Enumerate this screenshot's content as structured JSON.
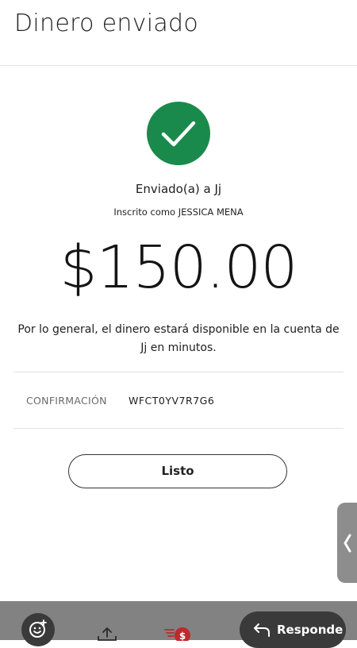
{
  "header": {
    "title": "Dinero enviado"
  },
  "status": {
    "icon": "check-circle-icon",
    "success_color": "#1a8a4c",
    "sent_to": "Enviado(a) a Jj",
    "enrolled_as": "Inscrito como JESSICA MENA"
  },
  "amount": "$150.00",
  "note": "Por lo general, el dinero estará disponible en la cuenta de Jj en minutos.",
  "confirmation": {
    "label": "CONFIRMACIÓN",
    "value": "WFCT0YV7R7G6"
  },
  "actions": {
    "done_label": "Listo"
  },
  "bottom_bar": {
    "icons": [
      "emoji-add-icon",
      "upload-icon",
      "send-money-icon",
      "app-icon"
    ],
    "reply_label": "Responde"
  },
  "side_handle": {
    "icon": "chevron-left-icon"
  }
}
